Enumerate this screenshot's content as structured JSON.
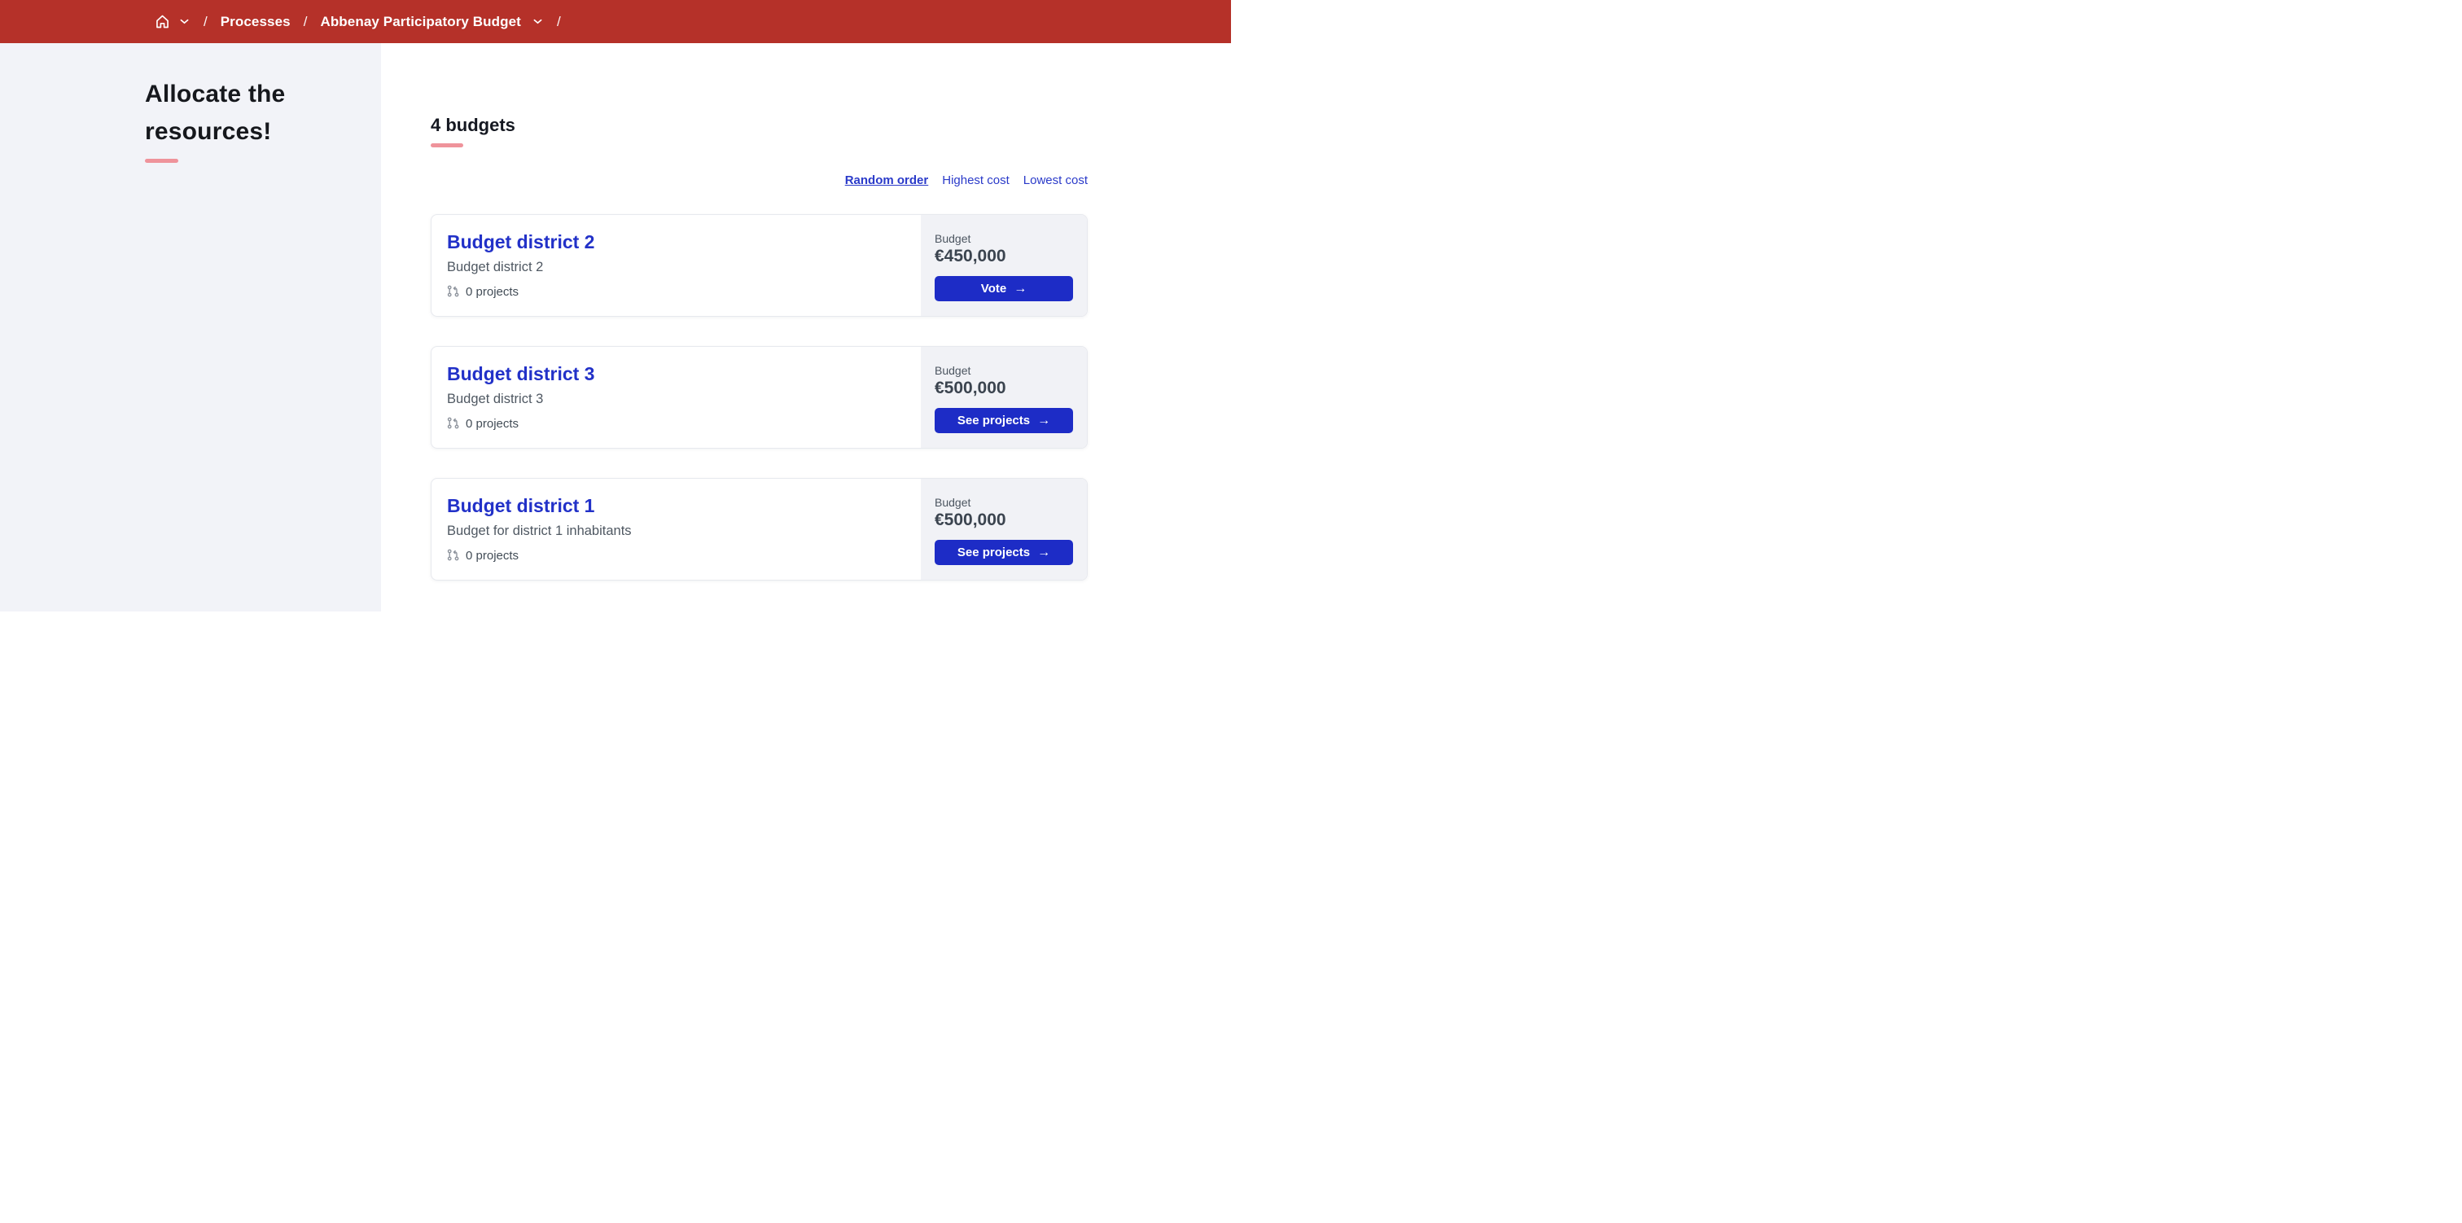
{
  "breadcrumb": {
    "separator": "/",
    "processes_label": "Processes",
    "process_title": "Abbenay Participatory Budget"
  },
  "sidebar": {
    "heading": "Allocate the resources!"
  },
  "main": {
    "heading": "4 budgets",
    "sort": [
      {
        "label": "Random order",
        "active": true
      },
      {
        "label": "Highest cost",
        "active": false
      },
      {
        "label": "Lowest cost",
        "active": false
      }
    ],
    "cards": [
      {
        "title": "Budget district 2",
        "description": "Budget district 2",
        "projects": "0 projects",
        "budget_label": "Budget",
        "amount": "€450,000",
        "action": "Vote"
      },
      {
        "title": "Budget district 3",
        "description": "Budget district 3",
        "projects": "0 projects",
        "budget_label": "Budget",
        "amount": "€500,000",
        "action": "See projects"
      },
      {
        "title": "Budget district 1",
        "description": "Budget for district 1 inhabitants",
        "projects": "0 projects",
        "budget_label": "Budget",
        "amount": "€500,000",
        "action": "See projects"
      }
    ]
  },
  "icons": {
    "arrow_right": "→"
  },
  "colors": {
    "topbar_red": "#b53129",
    "primary_blue": "#1f2ec6",
    "accent_salmon": "#ef939b",
    "sidebar_bg": "#f2f3f8",
    "panel_bg": "#f1f2f6"
  }
}
